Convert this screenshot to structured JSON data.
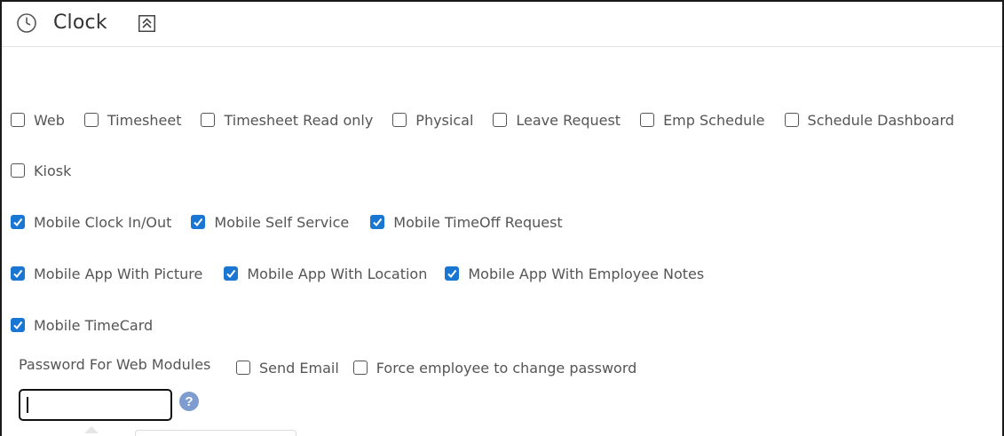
{
  "header": {
    "title": "Clock",
    "icon": "clock-icon",
    "collapse_icon": "double-chevron-up-icon"
  },
  "options": {
    "row1": [
      {
        "label": "Web",
        "checked": false
      },
      {
        "label": "Timesheet",
        "checked": false
      },
      {
        "label": "Timesheet Read only",
        "checked": false
      },
      {
        "label": "Physical",
        "checked": false
      },
      {
        "label": "Leave Request",
        "checked": false
      },
      {
        "label": "Emp Schedule",
        "checked": false
      },
      {
        "label": "Schedule Dashboard",
        "checked": false
      }
    ],
    "row2": [
      {
        "label": "Kiosk",
        "checked": false
      }
    ],
    "row3": [
      {
        "label": "Mobile Clock In/Out",
        "checked": true
      },
      {
        "label": "Mobile Self Service",
        "checked": true
      },
      {
        "label": "Mobile TimeOff Request",
        "checked": true
      }
    ],
    "row4": [
      {
        "label": "Mobile App With Picture",
        "checked": true
      },
      {
        "label": "Mobile App With Location",
        "checked": true
      },
      {
        "label": "Mobile App With Employee Notes",
        "checked": true
      }
    ],
    "row5": [
      {
        "label": "Mobile TimeCard",
        "checked": true
      }
    ]
  },
  "password": {
    "label": "Password For Web Modules",
    "value": "",
    "send_email": {
      "label": "Send Email",
      "checked": false
    },
    "force_change": {
      "label": "Force employee to change password",
      "checked": false
    },
    "help_symbol": "?"
  },
  "colors": {
    "checkbox_checked": "#1976d2",
    "help_icon": "#7e9ccf"
  }
}
